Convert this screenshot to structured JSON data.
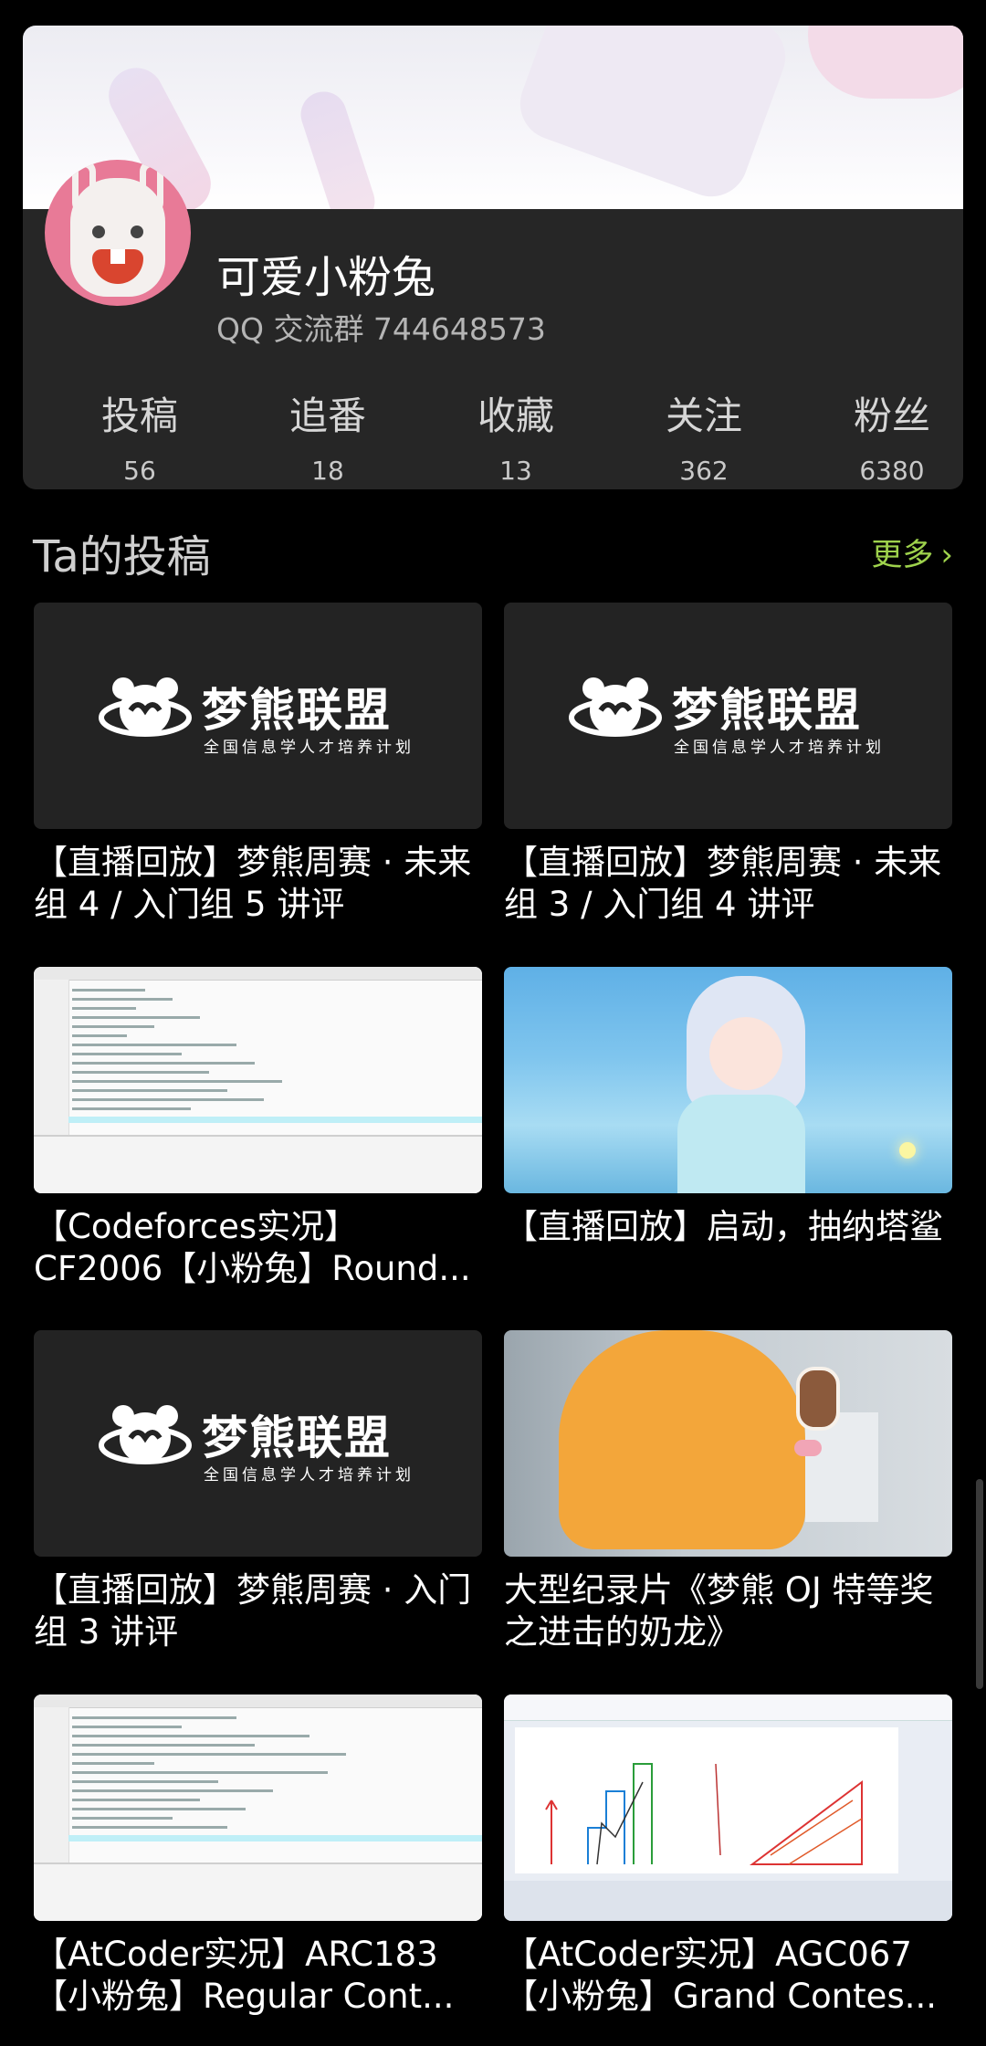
{
  "profile": {
    "nickname": "可爱小粉兔",
    "group": "QQ 交流群 744648573",
    "stats": [
      {
        "label": "投稿",
        "value": "56"
      },
      {
        "label": "追番",
        "value": "18"
      },
      {
        "label": "收藏",
        "value": "13"
      },
      {
        "label": "关注",
        "value": "362"
      },
      {
        "label": "粉丝",
        "value": "6380"
      }
    ]
  },
  "section": {
    "title": "Ta的投稿",
    "more": "更多",
    "more_icon": "chevron-right-icon"
  },
  "logo_text": {
    "brand": "梦熊联盟",
    "slogan": "全国信息学人才培养计划"
  },
  "videos": [
    {
      "title": "【直播回放】梦熊周赛 · 未来组 4 / 入门组 5 讲评",
      "thumb": "logo"
    },
    {
      "title": "【直播回放】梦熊周赛 · 未来组 3 / 入门组 4 讲评",
      "thumb": "logo"
    },
    {
      "title": "【Codeforces实况】CF2006【小粉兔】Round...",
      "thumb": "code"
    },
    {
      "title": "【直播回放】启动，抽纳塔鲨",
      "thumb": "anime"
    },
    {
      "title": "【直播回放】梦熊周赛 · 入门组 3 讲评",
      "thumb": "logo"
    },
    {
      "title": "大型纪录片《梦熊 OJ 特等奖之进击的奶龙》",
      "thumb": "duck"
    },
    {
      "title": "【AtCoder实况】ARC183【小粉兔】Regular Cont...",
      "thumb": "code"
    },
    {
      "title": "【AtCoder实况】AGC067【小粉兔】Grand Contes...",
      "thumb": "paint"
    }
  ],
  "colors": {
    "background": "#000000",
    "card": "#262626",
    "accent_green": "#9ed24c"
  }
}
